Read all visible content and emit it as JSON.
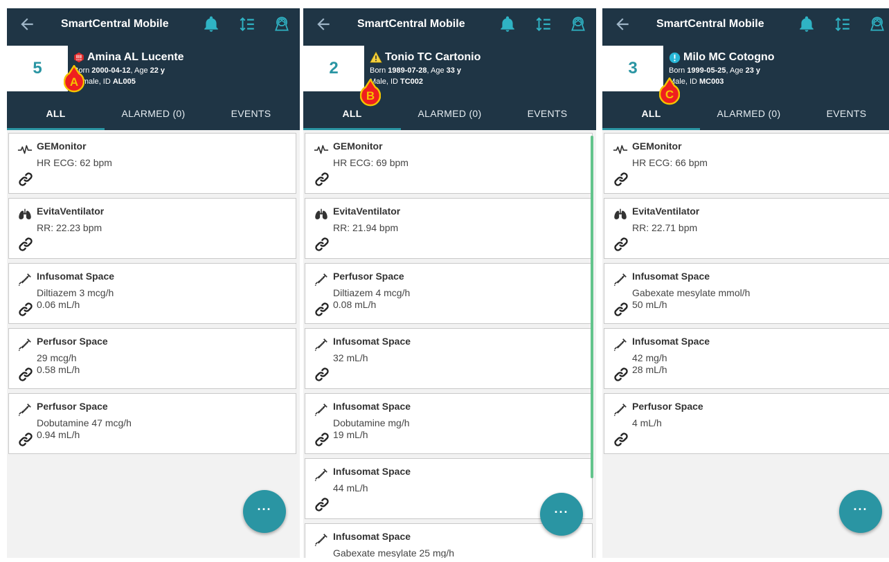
{
  "app_title": "SmartCentral Mobile",
  "tabs": [
    "ALL",
    "ALARMED (0)",
    "EVENTS"
  ],
  "fab_label": "···",
  "panels": [
    {
      "marker": "A",
      "bed": "5",
      "patient_name": "Amina AL Lucente",
      "alert_icon": "critical-alarm-icon",
      "born_label": "Born",
      "born": "2000-04-12",
      "age_label": ", Age",
      "age": "22 y",
      "sex": "Female",
      "id_label": ", ID",
      "id": "AL005",
      "devices": [
        {
          "icon": "ecg-icon",
          "name": "GEMonitor",
          "line1": "HR ECG: 62 bpm",
          "line2": ""
        },
        {
          "icon": "lungs-icon",
          "name": "EvitaVentilator",
          "line1": "RR: 22.23 bpm",
          "line2": ""
        },
        {
          "icon": "syringe-icon",
          "name": "Infusomat Space",
          "line1": "Diltiazem 3 mcg/h",
          "line2": "0.06 mL/h"
        },
        {
          "icon": "syringe-icon",
          "name": "Perfusor Space",
          "line1": "29 mcg/h",
          "line2": "0.58 mL/h"
        },
        {
          "icon": "syringe-icon",
          "name": "Perfusor Space",
          "line1": "Dobutamine 47 mcg/h",
          "line2": "0.94 mL/h"
        }
      ]
    },
    {
      "marker": "B",
      "bed": "2",
      "patient_name": "Tonio TC Cartonio",
      "alert_icon": "warning-icon",
      "born_label": "Born",
      "born": "1989-07-28",
      "age_label": ", Age",
      "age": "33 y",
      "sex": "Male",
      "id_label": ", ID",
      "id": "TC002",
      "devices": [
        {
          "icon": "ecg-icon",
          "name": "GEMonitor",
          "line1": "HR ECG: 69 bpm",
          "line2": ""
        },
        {
          "icon": "lungs-icon",
          "name": "EvitaVentilator",
          "line1": "RR: 21.94 bpm",
          "line2": ""
        },
        {
          "icon": "syringe-icon",
          "name": "Perfusor Space",
          "line1": "Diltiazem 4 mcg/h",
          "line2": "0.08 mL/h"
        },
        {
          "icon": "syringe-icon",
          "name": "Infusomat Space",
          "line1": "32 mL/h",
          "line2": ""
        },
        {
          "icon": "syringe-icon",
          "name": "Infusomat Space",
          "line1": "Dobutamine  mg/h",
          "line2": "19 mL/h"
        },
        {
          "icon": "syringe-icon",
          "name": "Infusomat Space",
          "line1": "44 mL/h",
          "line2": ""
        },
        {
          "icon": "syringe-icon",
          "name": "Infusomat Space",
          "line1": "Gabexate mesylate 25 mg/h",
          "line2": ""
        }
      ]
    },
    {
      "marker": "C",
      "bed": "3",
      "patient_name": "Milo MC Cotogno",
      "alert_icon": "info-alarm-icon",
      "born_label": "Born",
      "born": "1999-05-25",
      "age_label": ", Age",
      "age": "23 y",
      "sex": "Male",
      "id_label": ", ID",
      "id": "MC003",
      "devices": [
        {
          "icon": "ecg-icon",
          "name": "GEMonitor",
          "line1": "HR ECG: 66 bpm",
          "line2": ""
        },
        {
          "icon": "lungs-icon",
          "name": "EvitaVentilator",
          "line1": "RR: 22.71 bpm",
          "line2": ""
        },
        {
          "icon": "syringe-icon",
          "name": "Infusomat Space",
          "line1": "Gabexate mesylate  mmol/h",
          "line2": "50 mL/h"
        },
        {
          "icon": "syringe-icon",
          "name": "Infusomat Space",
          "line1": "42 mg/h",
          "line2": "28 mL/h"
        },
        {
          "icon": "syringe-icon",
          "name": "Perfusor Space",
          "line1": "4 mL/h",
          "line2": ""
        }
      ]
    }
  ]
}
